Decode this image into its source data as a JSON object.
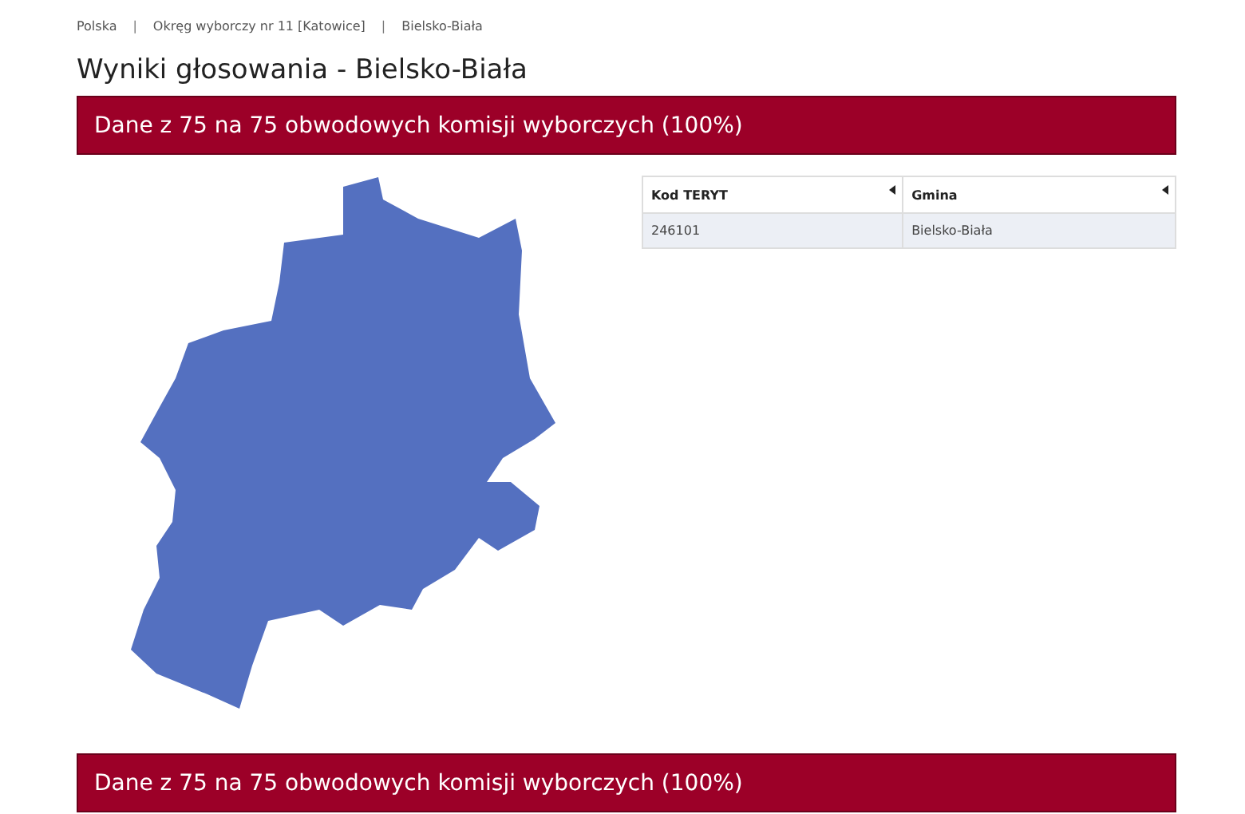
{
  "breadcrumbs": [
    {
      "label": "Polska"
    },
    {
      "label": "Okręg wyborczy nr 11 [Katowice]"
    },
    {
      "label": "Bielsko-Biała"
    }
  ],
  "breadcrumb_separator": "|",
  "title": "Wyniki głosowania - Bielsko-Biała",
  "banner_top": "Dane z 75 na 75 obwodowych komisji wyborczych (100%)",
  "table": {
    "columns": [
      "Kod TERYT",
      "Gmina"
    ],
    "rows": [
      [
        "246101",
        "Bielsko-Biała"
      ]
    ]
  },
  "banner_bottom": "Dane z 75 na 75 obwodowych komisji wyborczych (100%)"
}
